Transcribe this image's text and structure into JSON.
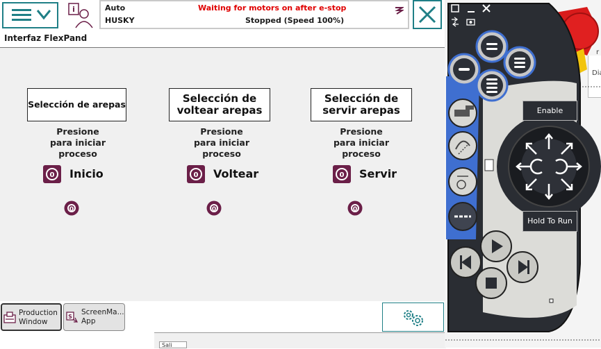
{
  "header": {
    "mode": "Auto",
    "robot_name": "HUSKY",
    "warning": "Waiting for motors on after e-stop",
    "state": "Stopped (Speed 100%)"
  },
  "app": {
    "title": "Interfaz FlexPand"
  },
  "panels": [
    {
      "box_label": "Selección de arepas",
      "instruction_line1": "Presione",
      "instruction_line2": "para iniciar",
      "instruction_line3": "proceso",
      "action_indicator": "0",
      "action_label": "Inicio",
      "small_indicator": "0"
    },
    {
      "box_label_line1": "Selección de",
      "box_label_line2": "voltear arepas",
      "instruction_line1": "Presione",
      "instruction_line2": "para iniciar",
      "instruction_line3": "proceso",
      "action_indicator": "0",
      "action_label": "Voltear",
      "small_indicator": "0"
    },
    {
      "box_label_line1": "Selección de",
      "box_label_line2": "servir arepas",
      "instruction_line1": "Presione",
      "instruction_line2": "para iniciar",
      "instruction_line3": "proceso",
      "action_indicator": "0",
      "action_label": "Servir",
      "small_indicator": "0"
    }
  ],
  "taskbar": {
    "production_line1": "Production",
    "production_line2": "Window",
    "screenmaker_line1": "ScreenMa...",
    "screenmaker_line2": "App"
  },
  "flexpendant": {
    "enable_label": "Enable",
    "hold_label": "Hold To Run"
  },
  "background_window": {
    "label_fragment_1": "Dia",
    "label_fragment_2": "r",
    "bottom_tab": "Sali"
  },
  "colors": {
    "accent_teal": "#1f7f86",
    "warning_red": "#e00000",
    "indicator_maroon": "#6b1f48",
    "pendant_blue": "#3f6fd0",
    "pendant_dark": "#23262b",
    "estop_red": "#d81b1b"
  }
}
